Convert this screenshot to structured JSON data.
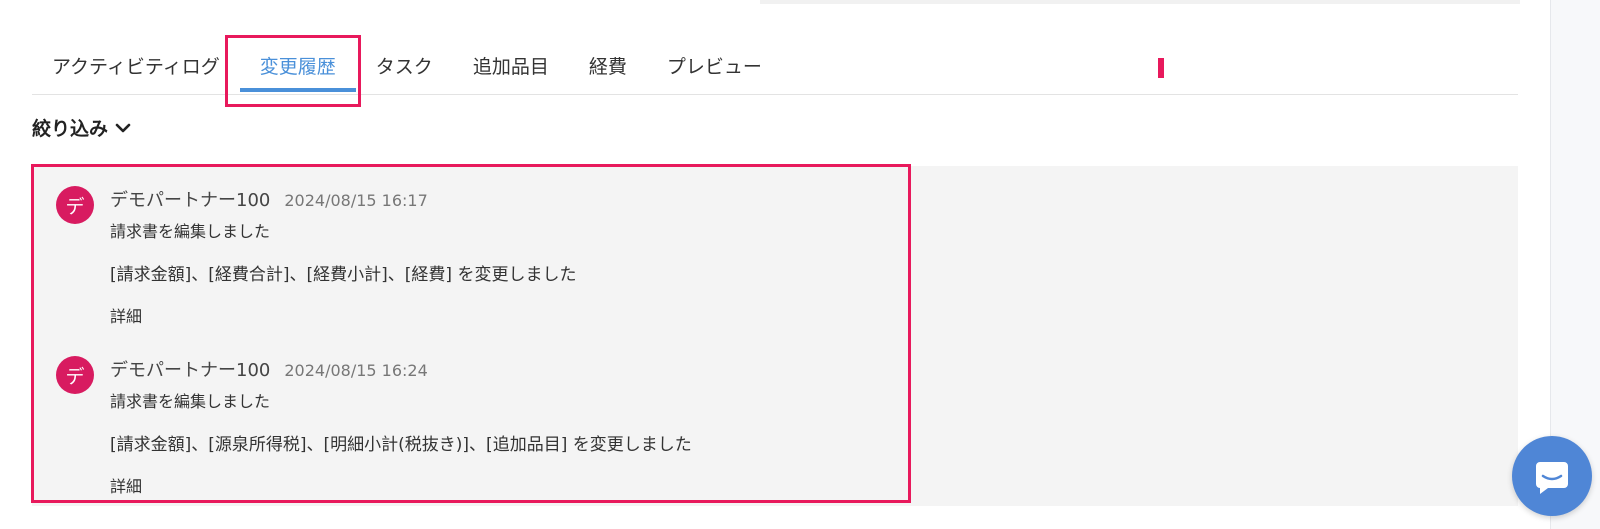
{
  "tabs": [
    {
      "label": "アクティビティログ"
    },
    {
      "label": "変更履歴"
    },
    {
      "label": "タスク"
    },
    {
      "label": "追加品目"
    },
    {
      "label": "経費"
    },
    {
      "label": "プレビュー"
    }
  ],
  "active_tab": "変更履歴",
  "filter": {
    "label": "絞り込み"
  },
  "history": [
    {
      "avatar": "デ",
      "user": "デモパートナー100",
      "time": "2024/08/15 16:17",
      "action": "請求書を編集しました",
      "changes": "[請求金額]、[経費合計]、[経費小計]、[経費] を変更しました",
      "detail": "詳細"
    },
    {
      "avatar": "デ",
      "user": "デモパートナー100",
      "time": "2024/08/15 16:24",
      "action": "請求書を編集しました",
      "changes": "[請求金額]、[源泉所得税]、[明細小計(税抜き)]、[追加品目] を変更しました",
      "detail": "詳細"
    }
  ],
  "colors": {
    "accent": "#4a90d9",
    "highlight": "#e8195c",
    "avatar": "#d81b60",
    "chat_button": "#4f86d6"
  },
  "icons": {
    "filter": "chevron-down-icon",
    "chat": "chat-bubble-icon"
  }
}
